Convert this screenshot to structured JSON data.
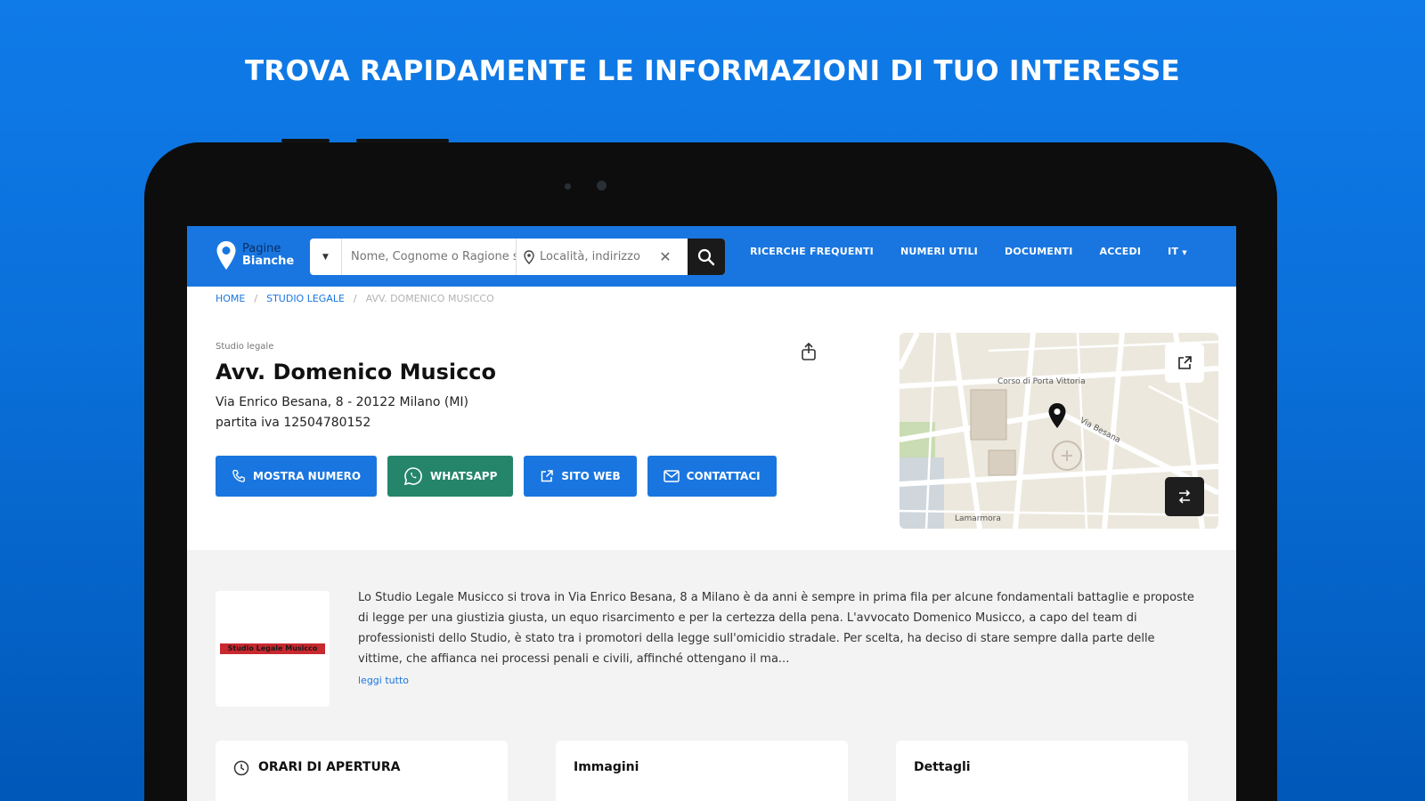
{
  "headline": "TROVA RAPIDAMENTE LE INFORMAZIONI  DI TUO INTERESSE",
  "colors": {
    "primary": "#1976e0",
    "whatsapp": "#25856a",
    "dark": "#1a1a1a"
  },
  "navbar": {
    "logo_top": "Pagine",
    "logo_bottom": "Bianche",
    "search": {
      "name_placeholder": "Nome, Cognome o Ragione sociale",
      "location_placeholder": "Località, indirizzo"
    },
    "links": [
      "RICERCHE FREQUENTI",
      "NUMERI UTILI",
      "DOCUMENTI",
      "ACCEDI"
    ],
    "language": "IT"
  },
  "breadcrumb": {
    "home": "HOME",
    "category": "STUDIO LEGALE",
    "current": "AVV. DOMENICO MUSICCO"
  },
  "business": {
    "category": "Studio legale",
    "name": "Avv. Domenico Musicco",
    "address": "Via Enrico Besana, 8 - 20122 Milano (MI)",
    "vat": "partita iva 12504780152"
  },
  "actions": {
    "show_number": "MOSTRA NUMERO",
    "whatsapp": "WHATSAPP",
    "website": "SITO WEB",
    "contact": "CONTATTACI"
  },
  "map": {
    "street_1": "Corso di Porta Vittoria",
    "street_2": "Lamarmora",
    "street_3": "Via Besana"
  },
  "about": {
    "logo_text": "Studio Legale Musicco",
    "description": "Lo Studio Legale Musicco si trova in Via Enrico Besana, 8 a Milano è da anni è sempre in prima fila per alcune fondamentali battaglie e proposte di legge per una giustizia giusta, un equo risarcimento e per la certezza della pena. L'avvocato Domenico Musicco, a capo del team di professionisti dello Studio, è stato tra i promotori della legge sull'omicidio stradale. Per scelta, ha deciso di stare sempre dalla parte delle vittime, che affianca nei processi penali e civili, affinché ottengano il ma...",
    "read_more": "leggi tutto"
  },
  "cards": {
    "hours": "ORARI DI APERTURA",
    "images": "Immagini",
    "details": "Dettagli"
  }
}
